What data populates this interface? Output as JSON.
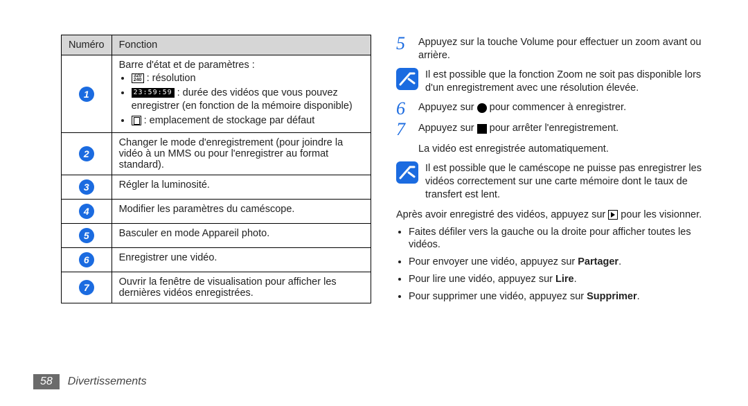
{
  "table": {
    "head_num": "Numéro",
    "head_fn": "Fonction",
    "rows": [
      {
        "num": "1",
        "title": "Barre d'état et de paramètres :",
        "bullets": {
          "res": " : résolution",
          "dur": " : durée des vidéos que vous pouvez enregistrer (en fonction de la mémoire disponible)",
          "store": " : emplacement de stockage par défaut"
        }
      },
      {
        "num": "2",
        "text": "Changer le mode d'enregistrement (pour joindre la vidéo à un MMS ou pour l'enregistrer au format standard)."
      },
      {
        "num": "3",
        "text": "Régler la luminosité."
      },
      {
        "num": "4",
        "text": "Modifier les paramètres du caméscope."
      },
      {
        "num": "5",
        "text": "Basculer en mode Appareil photo."
      },
      {
        "num": "6",
        "text": "Enregistrer une vidéo."
      },
      {
        "num": "7",
        "text": "Ouvrir la fenêtre de visualisation pour afficher les dernières vidéos enregistrées."
      }
    ]
  },
  "steps": {
    "s5": "Appuyez sur la touche Volume pour effectuer un zoom avant ou arrière.",
    "note1": "Il est possible que la fonction Zoom ne soit pas disponible lors d'un enregistrement avec une résolution élevée.",
    "s6_a": "Appuyez sur ",
    "s6_b": " pour commencer à enregistrer.",
    "s7_a": "Appuyez sur ",
    "s7_b": " pour arrêter l'enregistrement.",
    "autoline": "La vidéo est enregistrée automatiquement.",
    "note2": "Il est possible que le caméscope ne puisse pas enregistrer les vidéos correctement sur une carte mémoire dont le taux de transfert est lent.",
    "after_a": "Après avoir enregistré des vidéos, appuyez sur ",
    "after_b": " pour les visionner.",
    "bullets": {
      "b1": "Faites défiler vers la gauche ou la droite pour afficher toutes les vidéos.",
      "b2_a": "Pour envoyer une vidéo, appuyez sur ",
      "b2_b": "Partager",
      "b2_c": ".",
      "b3_a": "Pour lire une vidéo, appuyez sur ",
      "b3_b": "Lire",
      "b3_c": ".",
      "b4_a": "Pour supprimer une vidéo, appuyez sur ",
      "b4_b": "Supprimer",
      "b4_c": "."
    }
  },
  "stepnums": {
    "n5": "5",
    "n6": "6",
    "n7": "7"
  },
  "icons": {
    "res": "320\n240",
    "dur": "23:59:59"
  },
  "footer": {
    "page": "58",
    "section": "Divertissements"
  }
}
